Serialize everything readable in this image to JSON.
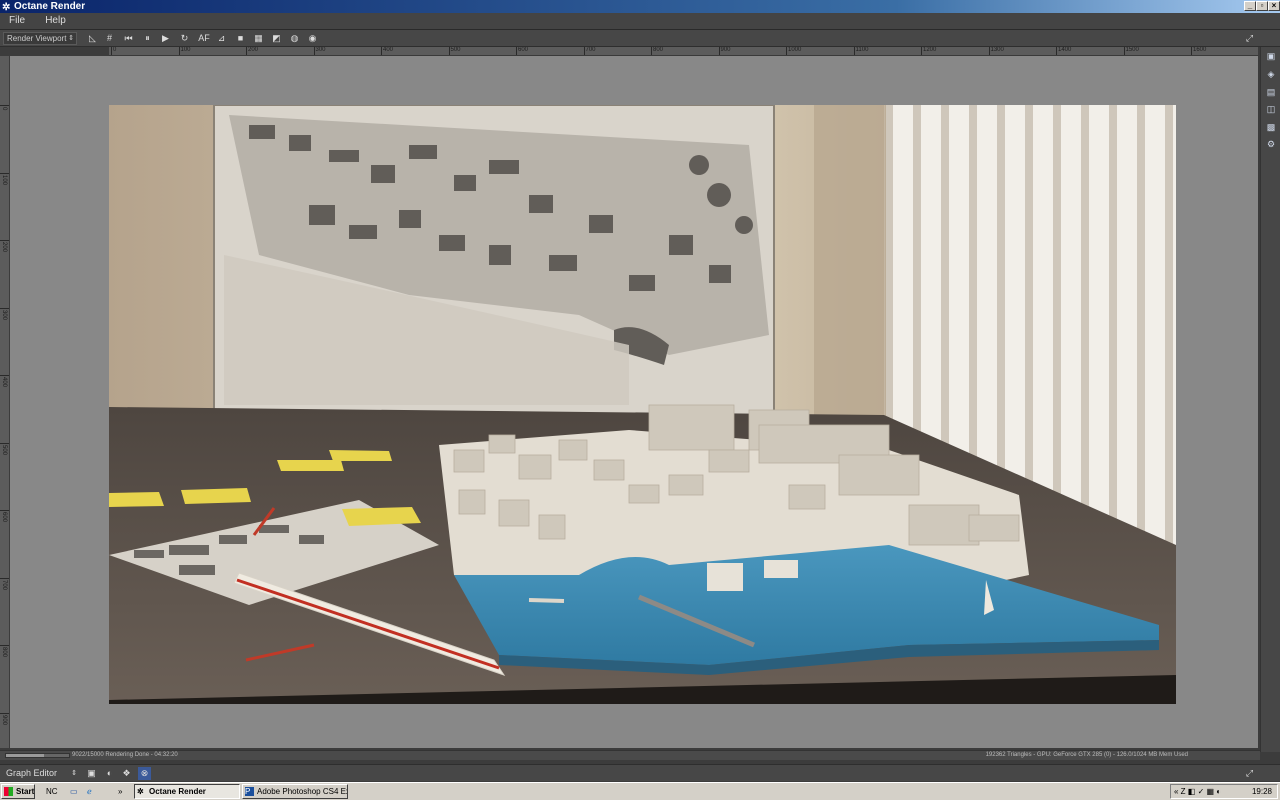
{
  "window": {
    "title": "Octane Render"
  },
  "menu": {
    "items": [
      "File",
      "Help"
    ]
  },
  "toolbar": {
    "viewport_select": "Render Viewport",
    "af_label": "AF"
  },
  "ruler": {
    "h_ticks": [
      "0",
      "100",
      "200",
      "300",
      "400",
      "500",
      "600",
      "700",
      "800",
      "900",
      "1000",
      "1100",
      "1200",
      "1300",
      "1400",
      "1500",
      "1600",
      "1700"
    ],
    "v_ticks": [
      "0",
      "100",
      "200",
      "300",
      "400",
      "500",
      "600",
      "700",
      "800",
      "900"
    ]
  },
  "status": {
    "left": "9022/15000 Rendering Done - 04:32:20",
    "right": "192362 Triangles - GPU: GeForce GTX 285 (0) - 126.0/1024 MB Mem Used",
    "progress_fraction": 0.6
  },
  "graph_editor": {
    "label": "Graph Editor"
  },
  "taskbar": {
    "start": "Start",
    "quick_label": "NC",
    "items": [
      "Octane Render",
      "Adobe Photoshop CS4 Ex..."
    ],
    "clock": "19:28"
  },
  "colors": {
    "title_start": "#0a246a",
    "title_end": "#a6caf0",
    "water": "#3b86ad",
    "sticky": "#e8d24a"
  }
}
